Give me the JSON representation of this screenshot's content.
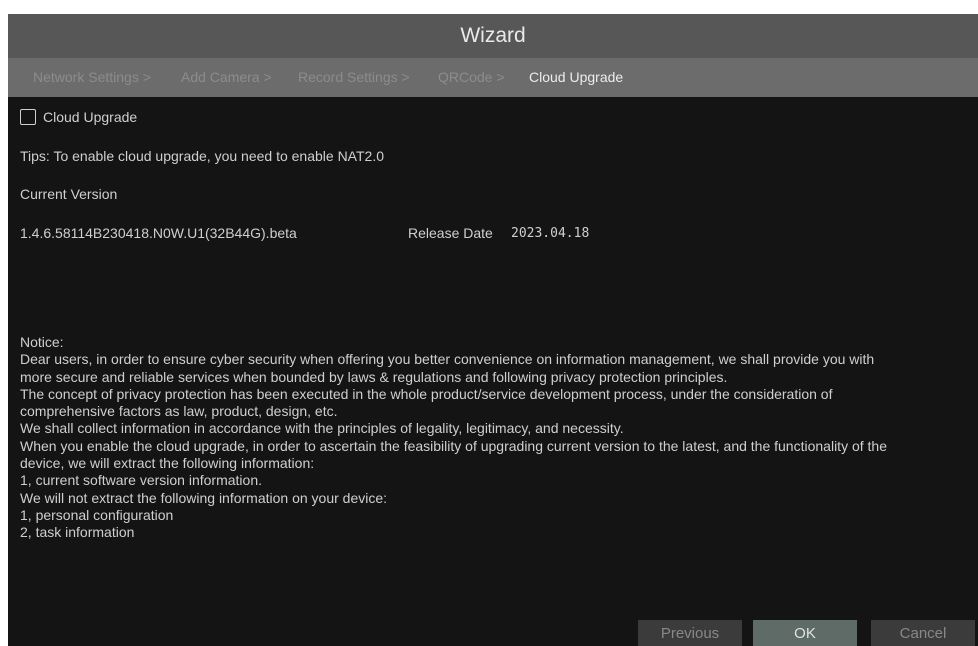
{
  "window": {
    "title": "Wizard"
  },
  "steps": [
    {
      "label": "Network Settings >"
    },
    {
      "label": "Add Camera >"
    },
    {
      "label": "Record Settings >"
    },
    {
      "label": "QRCode >"
    },
    {
      "label": "Cloud Upgrade"
    }
  ],
  "cloud_upgrade": {
    "checkbox_label": "Cloud Upgrade",
    "checked": false,
    "tips": "Tips: To enable cloud upgrade, you need to enable NAT2.0",
    "current_version_label": "Current Version",
    "version": "1.4.6.58114B230418.N0W.U1(32B44G).beta",
    "release_date_label": "Release Date",
    "release_date": "2023.04.18"
  },
  "notice": {
    "lines": [
      "Notice:",
      "Dear users, in order to ensure cyber security when offering you better convenience on information management, we shall provide you with",
      "more secure and reliable services when bounded by laws & regulations and following privacy protection principles.",
      "The concept of privacy protection has been executed in the whole product/service development process, under the consideration of",
      "comprehensive factors as law, product, design, etc.",
      "We shall collect information in accordance with the principles of legality, legitimacy, and necessity.",
      "When you enable the cloud upgrade, in order to ascertain the feasibility of upgrading current version to the latest, and the functionality of the",
      "device, we will extract the following information:",
      "1, current software version information.",
      "We will not extract the following information on your device:",
      "1, personal configuration",
      "2, task information"
    ]
  },
  "buttons": {
    "previous": "Previous",
    "ok": "OK",
    "cancel": "Cancel"
  },
  "colors": {
    "dialog_background": "#141414",
    "title_bar": "#575757",
    "step_bar": "#6c6c6c",
    "active_step_text": "#ececec",
    "inactive_step_text": "#8c8c8c",
    "ok_button": "#5f6b67",
    "button": "#3b3b3b"
  }
}
